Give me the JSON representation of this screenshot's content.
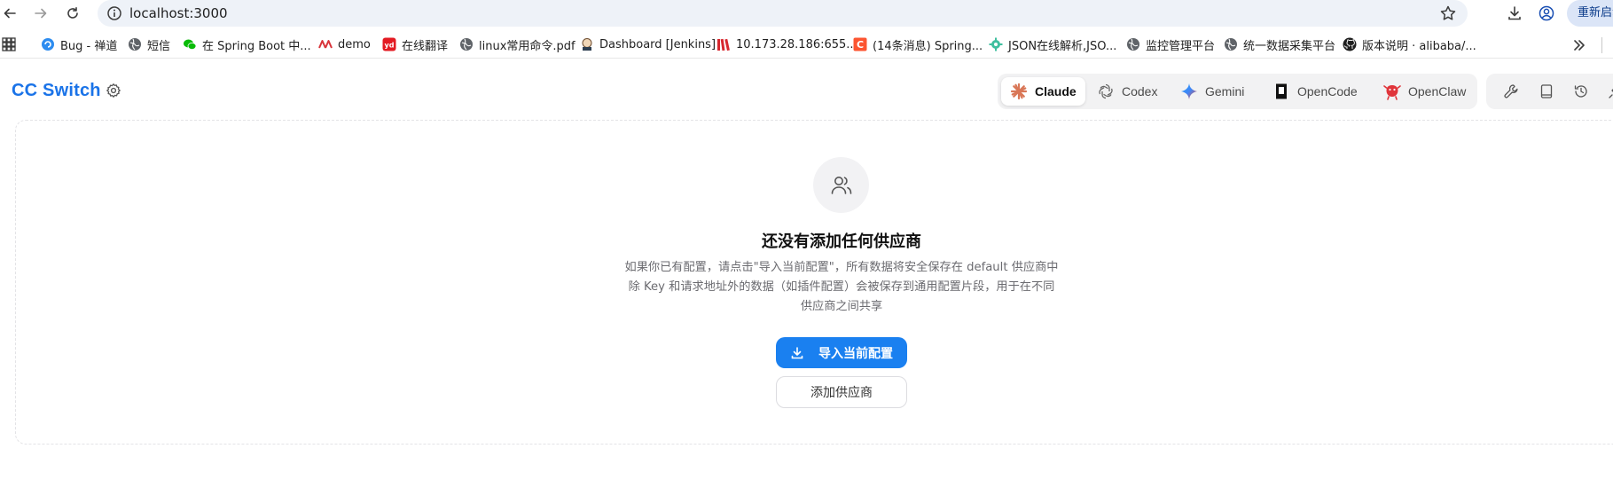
{
  "browser": {
    "url": "localhost:3000",
    "relaunch_label": "重新启动",
    "bookmarks": [
      {
        "label": "Bug - 禅道",
        "icon": "zentao-icon"
      },
      {
        "label": "短信",
        "icon": "globe-icon"
      },
      {
        "label": "在 Spring Boot 中...",
        "icon": "wechat-icon"
      },
      {
        "label": "demo",
        "icon": "demo-logo-icon"
      },
      {
        "label": "在线翻译",
        "icon": "youdao-icon"
      },
      {
        "label": "linux常用命令.pdf",
        "icon": "globe-icon"
      },
      {
        "label": "Dashboard [Jenkins]",
        "icon": "jenkins-icon"
      },
      {
        "label": "10.173.28.186:655...",
        "icon": "red-books-icon"
      },
      {
        "label": "(14条消息) Spring...",
        "icon": "csdn-icon"
      },
      {
        "label": "JSON在线解析,JSO...",
        "icon": "json-gear-icon"
      },
      {
        "label": "监控管理平台",
        "icon": "globe-icon"
      },
      {
        "label": "统一数据采集平台",
        "icon": "globe-icon"
      },
      {
        "label": "版本说明 · alibaba/...",
        "icon": "github-icon"
      }
    ]
  },
  "app": {
    "title": "CC Switch",
    "tools": [
      {
        "label": "Claude",
        "icon": "claude-icon",
        "active": true
      },
      {
        "label": "Codex",
        "icon": "openai-icon",
        "active": false
      },
      {
        "label": "Gemini",
        "icon": "gemini-icon",
        "active": false
      },
      {
        "label": "OpenCode",
        "icon": "opencode-icon",
        "active": false
      },
      {
        "label": "OpenClaw",
        "icon": "openclaw-icon",
        "active": false
      }
    ]
  },
  "empty": {
    "title": "还没有添加任何供应商",
    "desc_lines": [
      "如果你已有配置，请点击\"导入当前配置\"，所有数据将安全保存在 default 供应商中",
      "除 Key 和请求地址外的数据（如插件配置）会被保存到通用配置片段，用于在不同",
      "供应商之间共享"
    ],
    "import_label": "导入当前配置",
    "add_label": "添加供应商"
  },
  "colors": {
    "accent": "#1a80f0",
    "title_blue": "#1a73e8",
    "claude_orange": "#d97757",
    "gemini_blue": "#4285f4",
    "openclaw_red": "#e0343a"
  }
}
